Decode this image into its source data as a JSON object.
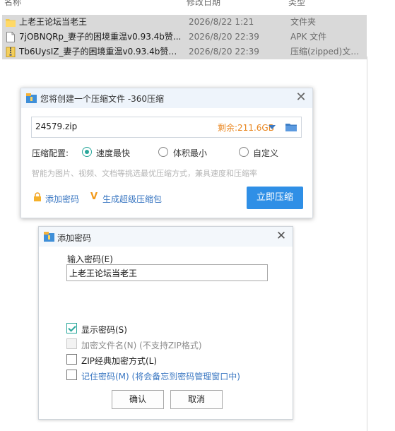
{
  "explorer": {
    "columns": {
      "name": "名称",
      "date": "修改日期",
      "type": "类型"
    },
    "files": [
      {
        "name": "上老王论坛当老王",
        "date": "2026/8/22 1:21",
        "type": "文件夹",
        "icon": "folder-icon"
      },
      {
        "name": "7jOBNQRp_妻子的困境重温v0.93.4b赞...",
        "date": "2026/8/20 22:39",
        "type": "APK 文件",
        "icon": "file-icon"
      },
      {
        "name": "Tb6UysIZ_妻子的困境重温v0.93.4b赞助...",
        "date": "2026/8/20 22:39",
        "type": "压缩(zipped)文件...",
        "icon": "zip-file-icon"
      }
    ]
  },
  "compress_dialog": {
    "title": "您将创建一个压缩文件 -360压缩",
    "filename": "24579.zip",
    "remaining": "剩余:211.6GB",
    "config_label": "压缩配置:",
    "options": [
      {
        "label": "速度最快",
        "selected": true
      },
      {
        "label": "体积最小",
        "selected": false
      },
      {
        "label": "自定义",
        "selected": false
      }
    ],
    "hint": "智能为图片、视频、文档等挑选最优压缩方式，兼具速度和压缩率",
    "add_password_link": "添加密码",
    "super_package_link": "生成超级压缩包",
    "compress_button": "立即压缩"
  },
  "password_dialog": {
    "title": "添加密码",
    "input_label": "输入密码(E)",
    "password_value": "上老王论坛当老王",
    "options": [
      {
        "label": "显示密码(S)",
        "checked": true,
        "disabled": false,
        "style": "normal"
      },
      {
        "label": "加密文件名(N) (不支持ZIP格式)",
        "checked": false,
        "disabled": true,
        "style": "disabled"
      },
      {
        "label": "ZIP经典加密方式(L)",
        "checked": false,
        "disabled": false,
        "style": "normal"
      },
      {
        "label": "记住密码(M) (将会备忘到密码管理窗口中)",
        "checked": false,
        "disabled": false,
        "style": "link"
      }
    ],
    "ok_button": "确认",
    "cancel_button": "取消"
  },
  "colors": {
    "accent_blue": "#2f8fe6",
    "link_blue": "#3a77c2",
    "remaining_orange": "#e9861f",
    "check_green": "#2aa79b",
    "selection_blue": "#cce8ff"
  }
}
